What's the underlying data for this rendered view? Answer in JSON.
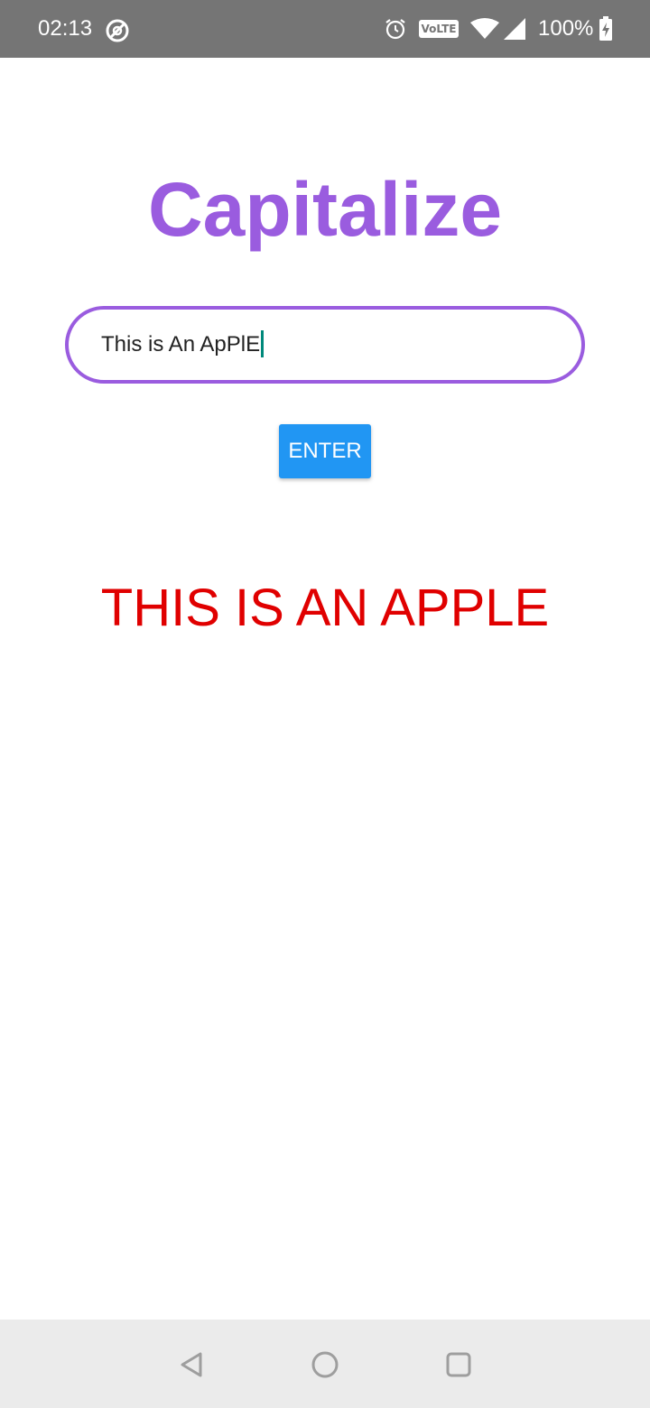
{
  "status_bar": {
    "time": "02:13",
    "volte_label": "VoLTE",
    "battery_percent": "100%",
    "icons": [
      "do-not-disturb-icon",
      "alarm-icon",
      "volte-icon",
      "wifi-icon",
      "cell-signal-icon",
      "battery-charging-icon"
    ]
  },
  "app": {
    "title": "Capitalize",
    "input": {
      "value": "This is An ApPlE"
    },
    "enter_button_label": "ENTER",
    "result": "THIS IS AN APPLE"
  },
  "nav_bar": {
    "icons": [
      "back-icon",
      "home-icon",
      "recents-icon"
    ]
  },
  "colors": {
    "status_bar_bg": "#757575",
    "title": "#9a5cdf",
    "input_border": "#9a5cdf",
    "cursor": "#00897b",
    "button_bg": "#2196f3",
    "result_text": "#e00000",
    "nav_bar_bg": "#ebebeb"
  }
}
